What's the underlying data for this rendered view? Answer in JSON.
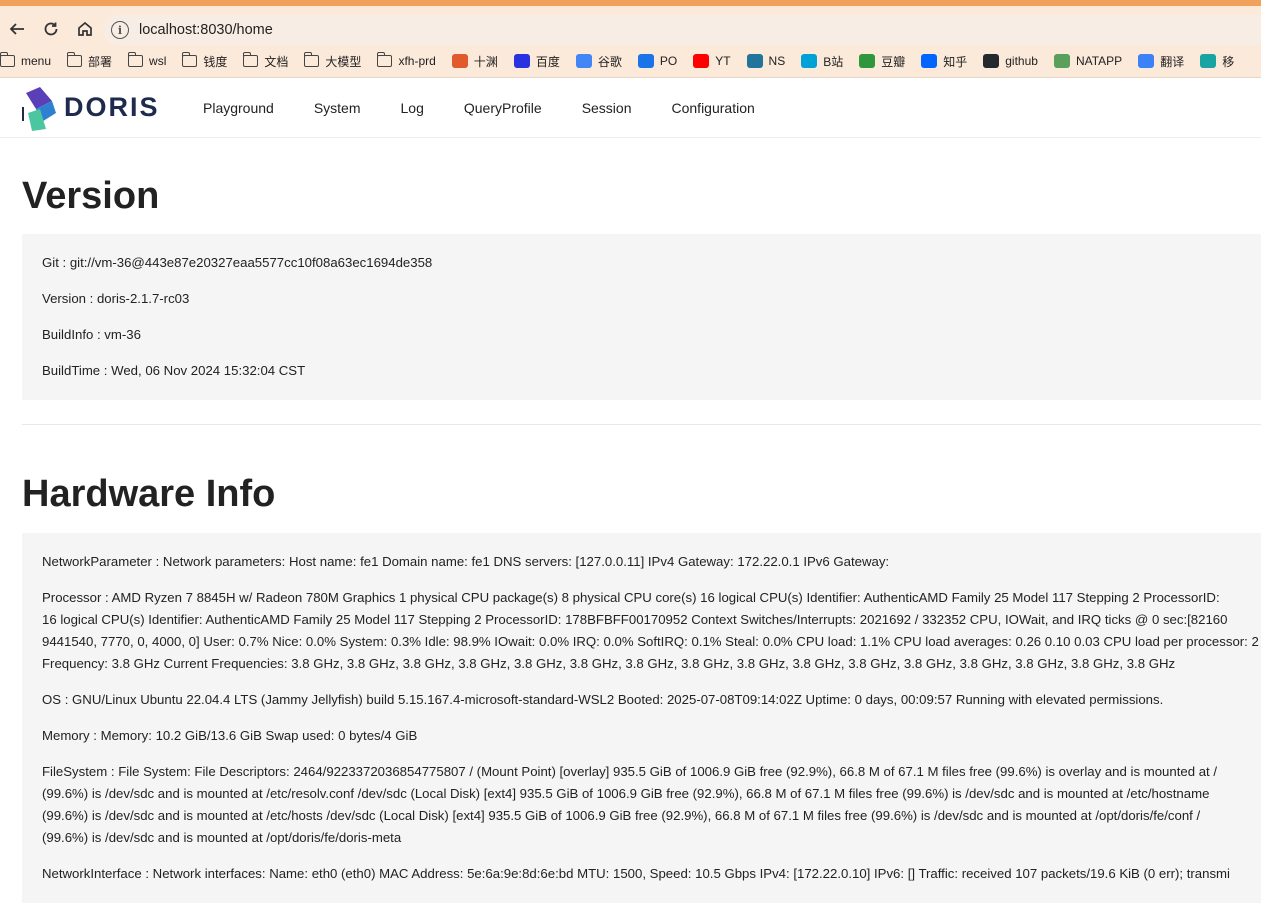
{
  "browser": {
    "url": "localhost:8030/home",
    "bookmarks": [
      {
        "label": "menu",
        "icon": "folder-icon",
        "color": "#444444"
      },
      {
        "label": "部署",
        "icon": "folder-icon",
        "color": "#444444"
      },
      {
        "label": "wsl",
        "icon": "folder-icon",
        "color": "#444444"
      },
      {
        "label": "钱度",
        "icon": "folder-icon",
        "color": "#444444"
      },
      {
        "label": "文档",
        "icon": "folder-icon",
        "color": "#444444"
      },
      {
        "label": "大模型",
        "icon": "folder-icon",
        "color": "#444444"
      },
      {
        "label": "xfh-prd",
        "icon": "folder-icon",
        "color": "#444444"
      },
      {
        "label": "十渊",
        "icon": "fire-icon",
        "color": "#e05a2b"
      },
      {
        "label": "百度",
        "icon": "baidu-icon",
        "color": "#2932e1"
      },
      {
        "label": "谷歌",
        "icon": "google-icon",
        "color": "#4285f4"
      },
      {
        "label": "PO",
        "icon": "on-icon",
        "color": "#1a73e8"
      },
      {
        "label": "YT",
        "icon": "youtube-icon",
        "color": "#ff0000"
      },
      {
        "label": "NS",
        "icon": "wordpress-icon",
        "color": "#21759b"
      },
      {
        "label": "B站",
        "icon": "bilibili-icon",
        "color": "#00a1d6"
      },
      {
        "label": "豆瓣",
        "icon": "douban-icon",
        "color": "#2e963d"
      },
      {
        "label": "知乎",
        "icon": "zhihu-icon",
        "color": "#0066ff"
      },
      {
        "label": "github",
        "icon": "github-icon",
        "color": "#24292e"
      },
      {
        "label": "NATAPP",
        "icon": "natapp-icon",
        "color": "#5aa05a"
      },
      {
        "label": "翻译",
        "icon": "translate-icon",
        "color": "#3b82f6"
      },
      {
        "label": "移",
        "icon": "mobile-icon",
        "color": "#1aa3a3"
      }
    ]
  },
  "app": {
    "logo_text": "DORIS",
    "nav": [
      "Playground",
      "System",
      "Log",
      "QueryProfile",
      "Session",
      "Configuration"
    ]
  },
  "version": {
    "title": "Version",
    "lines": [
      "Git : git://vm-36@443e87e20327eaa5577cc10f08a63ec1694de358",
      "Version : doris-2.1.7-rc03",
      "BuildInfo : vm-36",
      "BuildTime : Wed, 06 Nov 2024 15:32:04 CST"
    ]
  },
  "hardware": {
    "title": "Hardware Info",
    "paras": [
      [
        "NetworkParameter : Network parameters: Host name: fe1 Domain name: fe1 DNS servers: [127.0.0.11] IPv4 Gateway: 172.22.0.1 IPv6 Gateway:"
      ],
      [
        "Processor : AMD Ryzen 7 8845H w/ Radeon 780M Graphics 1 physical CPU package(s) 8 physical CPU core(s) 16 logical CPU(s) Identifier: AuthenticAMD Family 25 Model 117 Stepping 2 ProcessorID:",
        "16 logical CPU(s) Identifier: AuthenticAMD Family 25 Model 117 Stepping 2 ProcessorID: 178BFBFF00170952 Context Switches/Interrupts: 2021692 / 332352 CPU, IOWait, and IRQ ticks @ 0 sec:[82160",
        "9441540, 7770, 0, 4000, 0] User: 0.7% Nice: 0.0% System: 0.3% Idle: 98.9% IOwait: 0.0% IRQ: 0.0% SoftIRQ: 0.1% Steal: 0.0% CPU load: 1.1% CPU load averages: 0.26 0.10 0.03 CPU load per processor: 2",
        "Frequency: 3.8 GHz Current Frequencies: 3.8 GHz, 3.8 GHz, 3.8 GHz, 3.8 GHz, 3.8 GHz, 3.8 GHz, 3.8 GHz, 3.8 GHz, 3.8 GHz, 3.8 GHz, 3.8 GHz, 3.8 GHz, 3.8 GHz, 3.8 GHz, 3.8 GHz, 3.8 GHz"
      ],
      [
        "OS : GNU/Linux Ubuntu 22.04.4 LTS (Jammy Jellyfish) build 5.15.167.4-microsoft-standard-WSL2 Booted: 2025-07-08T09:14:02Z Uptime: 0 days, 00:09:57 Running with elevated permissions."
      ],
      [
        "Memory : Memory: 10.2 GiB/13.6 GiB Swap used: 0 bytes/4 GiB"
      ],
      [
        "FileSystem : File System: File Descriptors: 2464/9223372036854775807 / (Mount Point) [overlay] 935.5 GiB of 1006.9 GiB free (92.9%), 66.8 M of 67.1 M files free (99.6%) is overlay and is mounted at /",
        "(99.6%) is /dev/sdc and is mounted at /etc/resolv.conf /dev/sdc (Local Disk) [ext4] 935.5 GiB of 1006.9 GiB free (92.9%), 66.8 M of 67.1 M files free (99.6%) is /dev/sdc and is mounted at /etc/hostname",
        "(99.6%) is /dev/sdc and is mounted at /etc/hosts /dev/sdc (Local Disk) [ext4] 935.5 GiB of 1006.9 GiB free (92.9%), 66.8 M of 67.1 M files free (99.6%) is /dev/sdc and is mounted at /opt/doris/fe/conf /",
        "(99.6%) is /dev/sdc and is mounted at /opt/doris/fe/doris-meta"
      ],
      [
        "NetworkInterface : Network interfaces: Name: eth0 (eth0) MAC Address: 5e:6a:9e:8d:6e:bd MTU: 1500, Speed: 10.5 Gbps IPv4: [172.22.0.10] IPv6: [] Traffic: received 107 packets/19.6 KiB (0 err); transmi"
      ]
    ]
  }
}
